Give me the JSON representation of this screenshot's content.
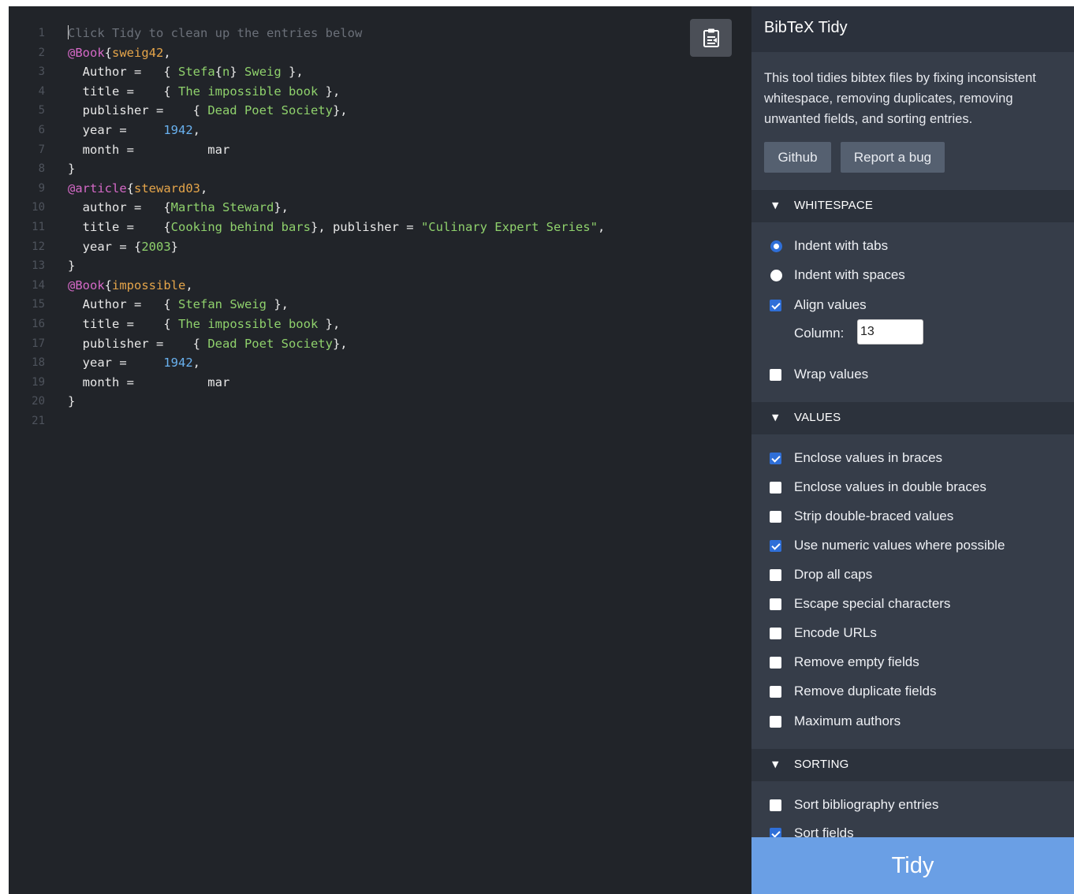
{
  "editor": {
    "lines": [
      {
        "n": "1",
        "segs": [
          {
            "t": "Click Tidy to clean up the entries below",
            "c": "comment"
          }
        ]
      },
      {
        "n": "2",
        "segs": [
          {
            "t": "@Book",
            "c": "type"
          },
          {
            "t": "{",
            "c": "text"
          },
          {
            "t": "sweig42",
            "c": "key"
          },
          {
            "t": ",",
            "c": "text"
          }
        ]
      },
      {
        "n": "3",
        "segs": [
          {
            "t": "  Author =   ",
            "c": "text"
          },
          {
            "t": "{",
            "c": "text"
          },
          {
            "t": " Stefa",
            "c": "str"
          },
          {
            "t": "{",
            "c": "text"
          },
          {
            "t": "n",
            "c": "str"
          },
          {
            "t": "}",
            "c": "text"
          },
          {
            "t": " Sweig ",
            "c": "str"
          },
          {
            "t": "},",
            "c": "text"
          }
        ]
      },
      {
        "n": "4",
        "segs": [
          {
            "t": "  title =    ",
            "c": "text"
          },
          {
            "t": "{",
            "c": "text"
          },
          {
            "t": " The impossible book ",
            "c": "str"
          },
          {
            "t": "},",
            "c": "text"
          }
        ]
      },
      {
        "n": "5",
        "segs": [
          {
            "t": "  publisher =    ",
            "c": "text"
          },
          {
            "t": "{",
            "c": "text"
          },
          {
            "t": " Dead Poet Society",
            "c": "str"
          },
          {
            "t": "},",
            "c": "text"
          }
        ]
      },
      {
        "n": "6",
        "segs": [
          {
            "t": "  year =     ",
            "c": "text"
          },
          {
            "t": "1942",
            "c": "num"
          },
          {
            "t": ",",
            "c": "text"
          }
        ]
      },
      {
        "n": "7",
        "segs": [
          {
            "t": "  month =          mar",
            "c": "text"
          }
        ]
      },
      {
        "n": "8",
        "segs": [
          {
            "t": "}",
            "c": "text"
          }
        ]
      },
      {
        "n": "9",
        "segs": [
          {
            "t": "@article",
            "c": "type"
          },
          {
            "t": "{",
            "c": "text"
          },
          {
            "t": "steward03",
            "c": "key"
          },
          {
            "t": ",",
            "c": "text"
          }
        ]
      },
      {
        "n": "10",
        "segs": [
          {
            "t": "  author =   ",
            "c": "text"
          },
          {
            "t": "{",
            "c": "text"
          },
          {
            "t": "Martha Steward",
            "c": "str"
          },
          {
            "t": "},",
            "c": "text"
          }
        ]
      },
      {
        "n": "11",
        "segs": [
          {
            "t": "  title =    ",
            "c": "text"
          },
          {
            "t": "{",
            "c": "text"
          },
          {
            "t": "Cooking behind bars",
            "c": "str"
          },
          {
            "t": "}, publisher = ",
            "c": "text"
          },
          {
            "t": "\"Culinary Expert Series\"",
            "c": "str"
          },
          {
            "t": ",",
            "c": "text"
          }
        ]
      },
      {
        "n": "12",
        "segs": [
          {
            "t": "  year = ",
            "c": "text"
          },
          {
            "t": "{",
            "c": "text"
          },
          {
            "t": "2003",
            "c": "str"
          },
          {
            "t": "}",
            "c": "text"
          }
        ]
      },
      {
        "n": "13",
        "segs": [
          {
            "t": "}",
            "c": "text"
          }
        ]
      },
      {
        "n": "14",
        "segs": [
          {
            "t": "@Book",
            "c": "type"
          },
          {
            "t": "{",
            "c": "text"
          },
          {
            "t": "impossible",
            "c": "key"
          },
          {
            "t": ",",
            "c": "text"
          }
        ]
      },
      {
        "n": "15",
        "segs": [
          {
            "t": "  Author =   ",
            "c": "text"
          },
          {
            "t": "{",
            "c": "text"
          },
          {
            "t": " Stefan Sweig ",
            "c": "str"
          },
          {
            "t": "},",
            "c": "text"
          }
        ]
      },
      {
        "n": "16",
        "segs": [
          {
            "t": "  title =    ",
            "c": "text"
          },
          {
            "t": "{",
            "c": "text"
          },
          {
            "t": " The impossible book ",
            "c": "str"
          },
          {
            "t": "},",
            "c": "text"
          }
        ]
      },
      {
        "n": "17",
        "segs": [
          {
            "t": "  publisher =    ",
            "c": "text"
          },
          {
            "t": "{",
            "c": "text"
          },
          {
            "t": " Dead Poet Society",
            "c": "str"
          },
          {
            "t": "},",
            "c": "text"
          }
        ]
      },
      {
        "n": "18",
        "segs": [
          {
            "t": "  year =     ",
            "c": "text"
          },
          {
            "t": "1942",
            "c": "num"
          },
          {
            "t": ",",
            "c": "text"
          }
        ]
      },
      {
        "n": "19",
        "segs": [
          {
            "t": "  month =          mar",
            "c": "text"
          }
        ]
      },
      {
        "n": "20",
        "segs": [
          {
            "t": "}",
            "c": "text"
          }
        ]
      },
      {
        "n": "21",
        "segs": []
      }
    ],
    "paste_icon": "clipboard-paste-icon"
  },
  "sidebar": {
    "title": "BibTeX Tidy",
    "description": "This tool tidies bibtex files by fixing inconsistent whitespace, removing duplicates, removing unwanted fields, and sorting entries.",
    "github_label": "Github",
    "bug_label": "Report a bug",
    "sections": {
      "whitespace": "WHITESPACE",
      "values": "VALUES",
      "sorting": "SORTING"
    },
    "whitespace": {
      "indent_tabs": "Indent with tabs",
      "indent_spaces": "Indent with spaces",
      "align_values": "Align values",
      "column_label": "Column:",
      "column_value": "13",
      "wrap_values": "Wrap values"
    },
    "values": {
      "enclose_braces": "Enclose values in braces",
      "enclose_double": "Enclose values in double braces",
      "strip_double": "Strip double-braced values",
      "numeric": "Use numeric values where possible",
      "drop_caps": "Drop all caps",
      "escape": "Escape special characters",
      "encode_urls": "Encode URLs",
      "remove_empty": "Remove empty fields",
      "remove_duplicate": "Remove duplicate fields",
      "max_authors": "Maximum authors"
    },
    "sorting": {
      "sort_entries": "Sort bibliography entries",
      "sort_fields": "Sort fields"
    },
    "tidy_label": "Tidy",
    "colors": {
      "accent": "#2f6fd8",
      "tidy": "#6a9fe5",
      "sidebar": "#363d49",
      "editor": "#212429"
    }
  }
}
